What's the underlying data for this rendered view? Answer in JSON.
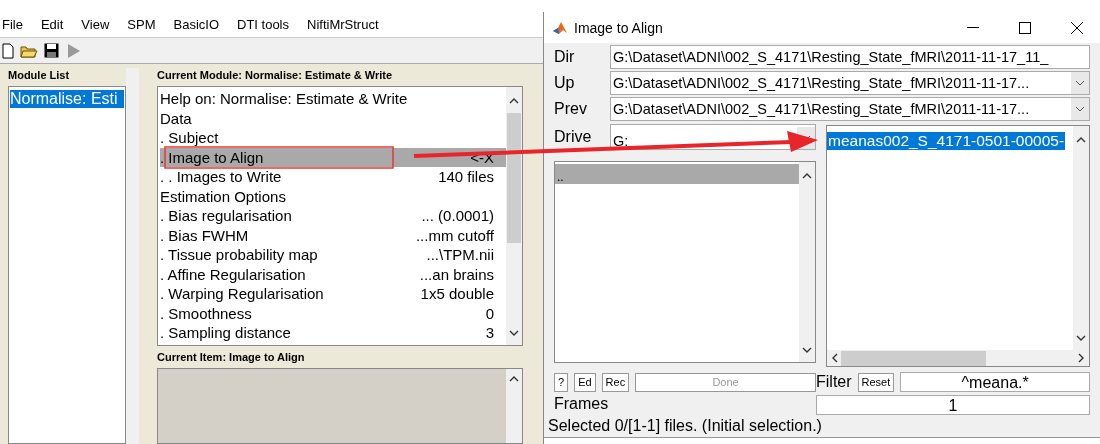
{
  "menu": [
    "File",
    "Edit",
    "View",
    "SPM",
    "BasicIO",
    "DTI tools",
    "NiftiMrStruct"
  ],
  "module_list": {
    "title": "Module List",
    "items": [
      {
        "label": "Normalise: Esti",
        "selected": true
      }
    ]
  },
  "current_module": {
    "title": "Current Module: Normalise: Estimate & Write",
    "rows": [
      {
        "label": "Help on: Normalise: Estimate & Write",
        "value": "",
        "selected": false
      },
      {
        "label": "Data",
        "value": "",
        "selected": false
      },
      {
        "label": ". Subject",
        "value": "",
        "selected": false
      },
      {
        "label": ". Image to Align",
        "value": "<-X",
        "selected": true
      },
      {
        "label": ". . Images to Write",
        "value": "140 files",
        "selected": false
      },
      {
        "label": "Estimation Options",
        "value": "",
        "selected": false
      },
      {
        "label": ". Bias regularisation",
        "value": "... (0.0001)",
        "selected": false
      },
      {
        "label": ". Bias FWHM",
        "value": "...mm cutoff",
        "selected": false
      },
      {
        "label": ". Tissue probability map",
        "value": "...\\TPM.nii",
        "selected": false
      },
      {
        "label": ". Affine Regularisation",
        "value": "...an brains",
        "selected": false
      },
      {
        "label": ". Warping Regularisation",
        "value": "1x5 double",
        "selected": false
      },
      {
        "label": ". Smoothness",
        "value": "0",
        "selected": false
      },
      {
        "label": ". Sampling distance",
        "value": "3",
        "selected": false
      }
    ]
  },
  "current_item": {
    "title": "Current Item: Image to Align"
  },
  "dialog": {
    "title": "Image to Align",
    "fields": [
      {
        "label": "Dir",
        "value": "G:\\Dataset\\ADNI\\002_S_4171\\Resting_State_fMRI\\2011-11-17_11_",
        "kind": "text"
      },
      {
        "label": "Up",
        "value": "G:\\Dataset\\ADNI\\002_S_4171\\Resting_State_fMRI\\2011-11-17...",
        "kind": "dropdown"
      },
      {
        "label": "Prev",
        "value": "G:\\Dataset\\ADNI\\002_S_4171\\Resting_State_fMRI\\2011-11-17...",
        "kind": "dropdown"
      }
    ],
    "drive": {
      "label": "Drive",
      "value": "G:"
    },
    "dirs": [
      {
        "label": "..",
        "selected": true
      }
    ],
    "files": [
      {
        "label": "meanas002_S_4171-0501-00005-",
        "selected": true
      }
    ],
    "buttons": [
      {
        "label": "?",
        "disabled": false
      },
      {
        "label": "Ed",
        "disabled": false
      },
      {
        "label": "Rec",
        "disabled": false
      },
      {
        "label": "Done",
        "disabled": true
      }
    ],
    "filter": {
      "label": "Filter",
      "button": "Reset",
      "value": "^meana.*"
    },
    "frames": {
      "label": "Frames",
      "value": "1"
    },
    "status": "Selected 0/[1-1] files. (Initial selection.)"
  }
}
